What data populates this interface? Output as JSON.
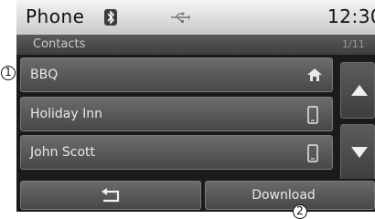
{
  "statusbar": {
    "title": "Phone",
    "time": "12:30"
  },
  "subheader": {
    "title": "Contacts",
    "page": "1/11"
  },
  "contacts": [
    {
      "name": "BBQ",
      "icon": "home-icon"
    },
    {
      "name": "Holiday Inn",
      "icon": "mobile-phone-icon"
    },
    {
      "name": "John Scott",
      "icon": "mobile-phone-icon"
    }
  ],
  "bottombar": {
    "download_label": "Download"
  },
  "callouts": {
    "one": "1",
    "two": "2"
  },
  "colors": {
    "screen_bg": "#1b1b1b",
    "statusbar_bg": "#e6e6e6",
    "text_light": "#e8e8e8"
  }
}
